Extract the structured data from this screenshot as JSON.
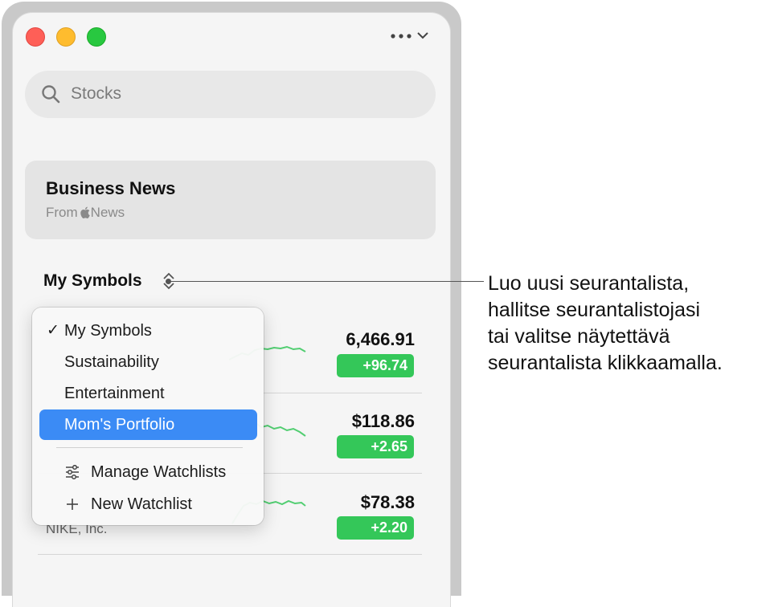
{
  "window": {
    "more_label": "...",
    "search": {
      "placeholder": "Stocks"
    },
    "news": {
      "title": "Business News",
      "from_prefix": "From",
      "from_source": "News"
    },
    "watchlist_header": "My Symbols",
    "rows": [
      {
        "price": "6,466.91",
        "change": "+96.74"
      },
      {
        "price": "$118.86",
        "change": "+2.65"
      },
      {
        "price": "$78.38",
        "change": "+2.20",
        "company": "NIKE, Inc."
      }
    ],
    "menu": {
      "items": [
        {
          "label": "My Symbols",
          "checked": true
        },
        {
          "label": "Sustainability"
        },
        {
          "label": "Entertainment"
        },
        {
          "label": "Mom's Portfolio",
          "highlighted": true
        }
      ],
      "actions": [
        {
          "label": "Manage Watchlists",
          "icon": "sliders-icon"
        },
        {
          "label": "New Watchlist",
          "icon": "plus-icon"
        }
      ]
    }
  },
  "callout": {
    "lines": [
      "Luo uusi seurantalista,",
      "hallitse seurantalistojasi",
      "tai valitse näytettävä",
      "seurantalista klikkaamalla."
    ]
  },
  "colors": {
    "accent": "#3b8bf5",
    "positive": "#34c759"
  }
}
